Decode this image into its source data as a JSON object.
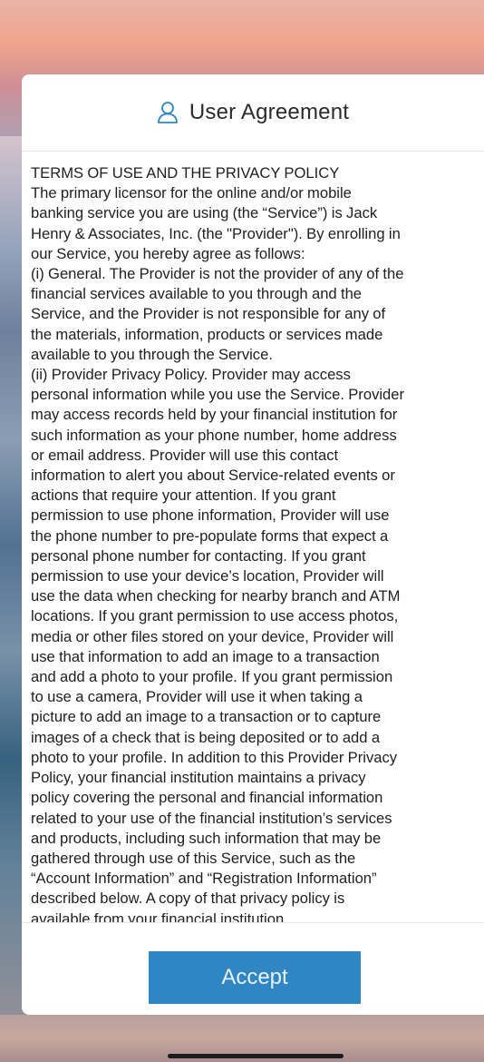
{
  "header": {
    "icon": "user-icon",
    "title": "User Agreement"
  },
  "terms": {
    "text": "TERMS OF USE AND THE PRIVACY POLICY\nThe primary licensor for the online and/or mobile\nbanking service you are using (the “Service”) is Jack\nHenry & Associates, Inc. (the \"Provider\"). By enrolling in\nour Service, you hereby agree as follows:\n(i) General. The Provider is not the provider of any of the\nfinancial services available to you through and the\nService, and the Provider is not responsible for any of\nthe materials, information, products or services made\navailable to you through the Service.\n(ii) Provider Privacy Policy. Provider may access\npersonal information while you use the Service. Provider\nmay access records held by your financial institution for\nsuch information as your phone number, home address\nor email address. Provider will use this contact\ninformation to alert you about Service-related events or\nactions that require your attention. If you grant\npermission to use phone information, Provider will use\nthe phone number to pre-populate forms that expect a\npersonal phone number for contacting. If you grant\npermission to use your device’s location, Provider will\nuse the data when checking for nearby branch and ATM\nlocations. If you grant permission to use access photos,\nmedia or other files stored on your device, Provider will\nuse that information to add an image to a transaction\nand add a photo to your profile. If you grant permission\nto use a camera, Provider will use it when taking a\npicture to add an image to a transaction or to capture\nimages of a check that is being deposited or to add a\nphoto to your profile. In addition to this Provider Privacy\nPolicy, your financial institution maintains a privacy\npolicy covering the personal and financial information\nrelated to your use of the financial institution’s services\nand products, including such information that may be\ngathered through use of this Service, such as the\n“Account Information” and “Registration Information”\ndescribed below. A copy of that privacy policy is\navailable from your financial institution."
  },
  "actions": {
    "accept_label": "Accept"
  },
  "colors": {
    "accent": "#2f86c2",
    "icon": "#2f86c2"
  }
}
